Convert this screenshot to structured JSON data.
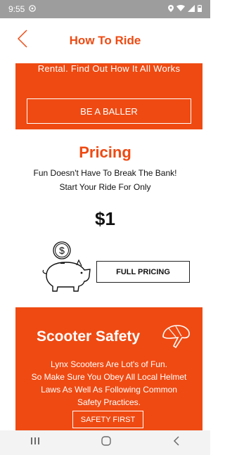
{
  "status_bar": {
    "time": "9:55"
  },
  "header": {
    "back_icon": "chevron-left-icon",
    "title": "How To Ride"
  },
  "section_top": {
    "text": "Rental. Find Out How It All Works",
    "button": "BE A BALLER"
  },
  "pricing": {
    "title": "Pricing",
    "line1": "Fun Doesn't Have To Break The Bank!",
    "line2": "Start Your Ride For Only",
    "price": "$1",
    "button": "FULL PRICING"
  },
  "safety": {
    "title": "Scooter Safety",
    "lines": [
      "Lynx Scooters Are Lot's of Fun.",
      "So Make Sure You Obey All Local Helmet",
      "Laws As Well As Following Common",
      "Safety Practices."
    ],
    "button": "SAFETY FIRST"
  },
  "colors": {
    "accent": "#ef4a12",
    "status_bar": "#9d9d9d"
  },
  "nav": {
    "items": [
      "recents-icon",
      "home-icon",
      "back-icon"
    ]
  }
}
